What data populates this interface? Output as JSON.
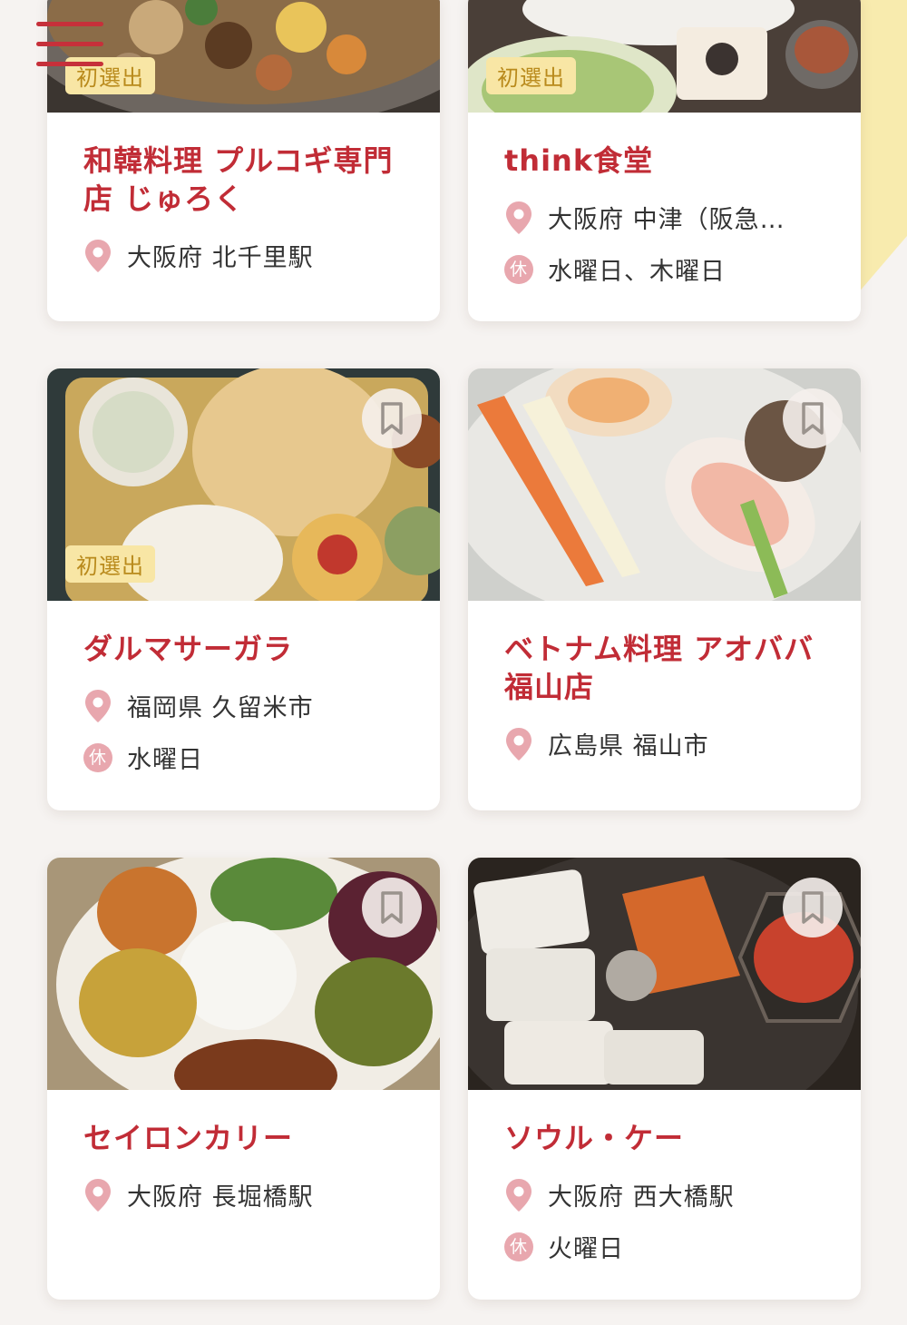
{
  "menu": {
    "icon": "hamburger-menu-icon"
  },
  "colors": {
    "accent": "#c12c36",
    "badge_bg": "#f8e6a5",
    "pin": "#e8a7ae"
  },
  "cards": [
    {
      "title": "和韓料理 プルコギ専門店 じゅろく",
      "badge": "初選出",
      "location": "大阪府 北千里駅",
      "holiday": ""
    },
    {
      "title": "think食堂",
      "badge": "初選出",
      "location": "大阪府 中津（阪急…",
      "holiday": "水曜日、木曜日",
      "holiday_icon": "休"
    },
    {
      "title": "ダルマサーガラ",
      "badge": "初選出",
      "location": "福岡県 久留米市",
      "holiday": "水曜日",
      "holiday_icon": "休"
    },
    {
      "title": "ベトナム料理 アオババ 福山店",
      "badge": "",
      "location": "広島県 福山市",
      "holiday": ""
    },
    {
      "title": "セイロンカリー",
      "badge": "",
      "location": "大阪府 長堀橋駅",
      "holiday": ""
    },
    {
      "title": "ソウル・ケー",
      "badge": "",
      "location": "大阪府 西大橋駅",
      "holiday": "火曜日",
      "holiday_icon": "休"
    }
  ]
}
